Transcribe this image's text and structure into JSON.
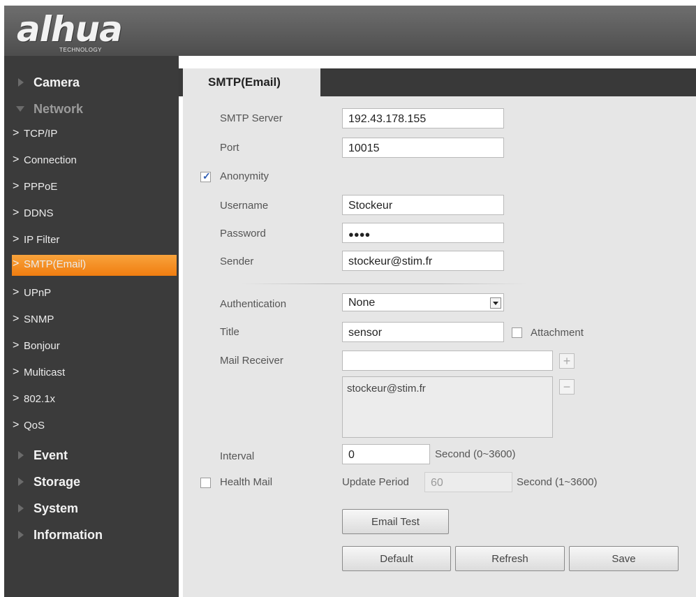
{
  "header": {
    "logo_text": "alhua",
    "logo_sub": "TECHNOLOGY"
  },
  "sidebar": {
    "groups": {
      "camera": "Camera",
      "network": "Network",
      "event": "Event",
      "storage": "Storage",
      "system": "System",
      "information": "Information"
    },
    "items": [
      "TCP/IP",
      "Connection",
      "PPPoE",
      "DDNS",
      "IP Filter",
      "SMTP(Email)",
      "UPnP",
      "SNMP",
      "Bonjour",
      "Multicast",
      "802.1x",
      "QoS"
    ],
    "chevron": ">",
    "active_item": "SMTP(Email)"
  },
  "tab": {
    "label": "SMTP(Email)"
  },
  "form": {
    "smtp_server_label": "SMTP Server",
    "smtp_server_value": "192.43.178.155",
    "port_label": "Port",
    "port_value": "10015",
    "anonymity_label": "Anonymity",
    "anonymity_checked": true,
    "username_label": "Username",
    "username_value": "Stockeur",
    "password_label": "Password",
    "password_value": "●●●●",
    "sender_label": "Sender",
    "sender_value": "stockeur@stim.fr",
    "authentication_label": "Authentication",
    "authentication_value": "None",
    "title_label": "Title",
    "title_value": "sensor",
    "attachment_label": "Attachment",
    "attachment_checked": false,
    "mail_receiver_label": "Mail Receiver",
    "mail_receiver_value": "",
    "receiver_list": [
      "stockeur@stim.fr"
    ],
    "add_symbol": "+",
    "remove_symbol": "−",
    "interval_label": "Interval",
    "interval_value": "0",
    "interval_unit": "Second (0~3600)",
    "health_mail_label": "Health Mail",
    "health_mail_checked": false,
    "update_period_label": "Update Period",
    "update_period_value": "60",
    "update_period_unit": "Second (1~3600)"
  },
  "buttons": {
    "email_test": "Email Test",
    "default": "Default",
    "refresh": "Refresh",
    "save": "Save"
  },
  "colors": {
    "accent": "#f28a1f",
    "sidebar_bg": "#3b3b3b",
    "content_bg": "#e6e6e6",
    "check": "#2f5db3"
  },
  "icons": {
    "anonymity_check": "checkmark-icon",
    "select": "dropdown-arrow-icon",
    "add": "plus-icon",
    "remove": "minus-icon"
  }
}
